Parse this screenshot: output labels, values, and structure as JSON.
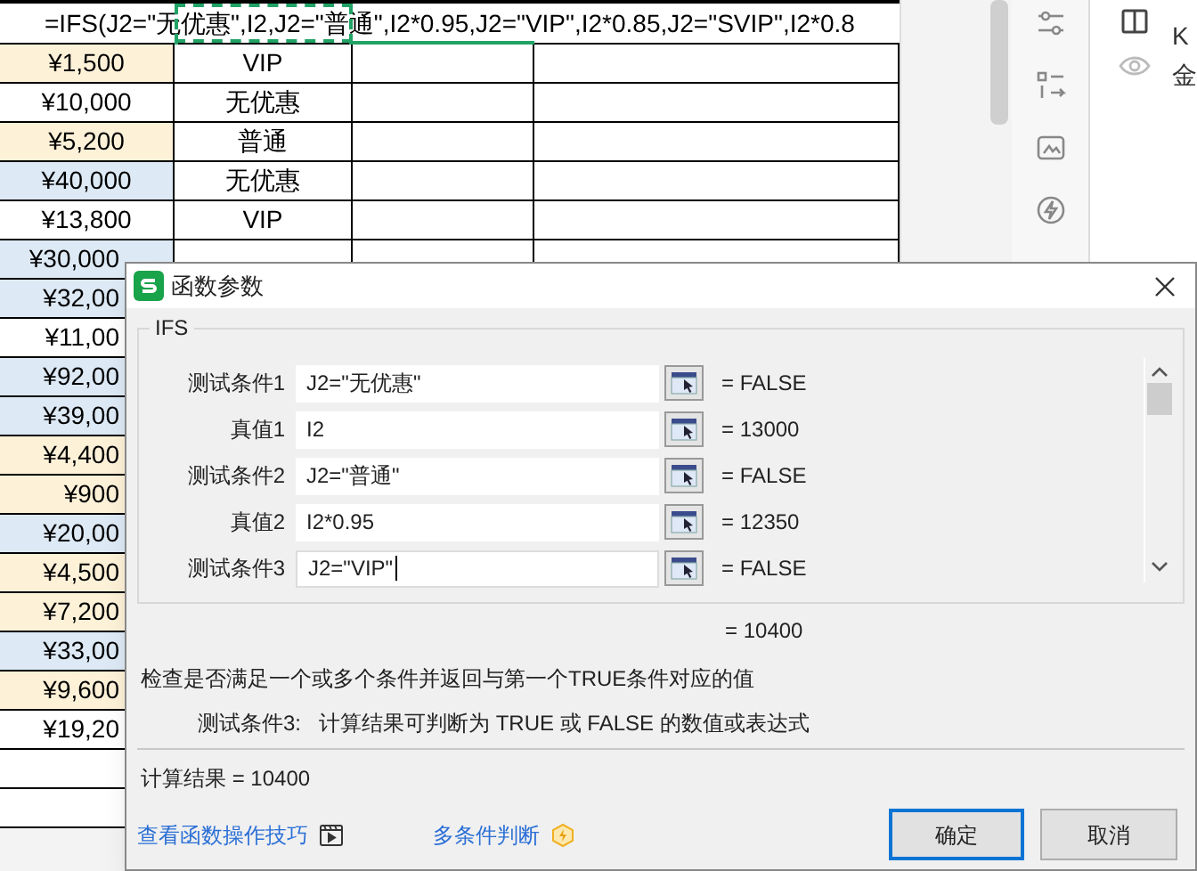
{
  "formula_bar": {
    "text": "=IFS(J2=\"无优惠\",I2,J2=\"普通\",I2*0.95,J2=\"VIP\",I2*0.85,J2=\"SVIP\",I2*0.8"
  },
  "rows": [
    {
      "amount": "¥1,500",
      "type": "VIP",
      "color": "#fdf1d8"
    },
    {
      "amount": "¥10,000",
      "type": "无优惠",
      "color": "#ffffff"
    },
    {
      "amount": "¥5,200",
      "type": "普通",
      "color": "#fdf1d8"
    },
    {
      "amount": "¥40,000",
      "type": "无优惠",
      "color": "#dde9f5"
    },
    {
      "amount": "¥13,800",
      "type": "VIP",
      "color": "#ffffff"
    },
    {
      "amount": "¥30,000",
      "color": "#dde9f5"
    },
    {
      "amount": "¥32,00",
      "color": "#dde9f5"
    },
    {
      "amount": "¥11,00",
      "color": "#ffffff"
    },
    {
      "amount": "¥92,00",
      "color": "#dde9f5"
    },
    {
      "amount": "¥39,00",
      "color": "#dde9f5"
    },
    {
      "amount": "¥4,400",
      "color": "#fdf1d8"
    },
    {
      "amount": "¥900",
      "color": "#fdf1d8"
    },
    {
      "amount": "¥20,00",
      "color": "#dde9f5"
    },
    {
      "amount": "¥4,500",
      "color": "#fdf1d8"
    },
    {
      "amount": "¥7,200",
      "color": "#fdf1d8"
    },
    {
      "amount": "¥33,00",
      "color": "#dde9f5"
    },
    {
      "amount": "¥9,600",
      "color": "#fdf1d8"
    },
    {
      "amount": "¥19,20",
      "color": "#ffffff"
    }
  ],
  "side_panel": {
    "texts": [
      "K",
      "金"
    ]
  },
  "dialog": {
    "title": "函数参数",
    "function": "IFS",
    "params": [
      {
        "label": "测试条件1",
        "value": "J2=\"无优惠\"",
        "result": "= FALSE",
        "focused": false
      },
      {
        "label": "真值1",
        "value": "I2",
        "result": "= 13000",
        "focused": false
      },
      {
        "label": "测试条件2",
        "value": "J2=\"普通\"",
        "result": "= FALSE",
        "focused": false
      },
      {
        "label": "真值2",
        "value": "I2*0.95",
        "result": "= 12350",
        "focused": false
      },
      {
        "label": "测试条件3",
        "value": "J2=\"VIP\"",
        "result": "= FALSE",
        "focused": true
      }
    ],
    "formula_result": "= 10400",
    "description": "检查是否满足一个或多个条件并返回与第一个TRUE条件对应的值",
    "param_help_label": "测试条件3:",
    "param_help": "计算结果可判断为 TRUE 或 FALSE 的数值或表达式",
    "calc_result": "计算结果 = 10400",
    "links": [
      {
        "text": "查看函数操作技巧",
        "kind": "video"
      },
      {
        "text": "多条件判断",
        "kind": "badge"
      }
    ],
    "buttons": [
      {
        "label": "确定",
        "default": true
      },
      {
        "label": "取消",
        "default": false
      }
    ]
  }
}
